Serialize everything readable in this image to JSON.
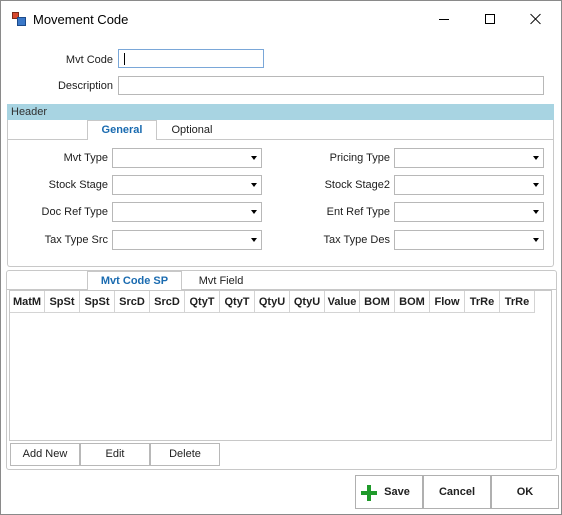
{
  "window": {
    "title": "Movement Code"
  },
  "form": {
    "mvt_code_label": "Mvt Code",
    "mvt_code_value": "",
    "description_label": "Description",
    "description_value": ""
  },
  "header": {
    "title": "Header",
    "tabs": [
      {
        "label": "General",
        "active": true
      },
      {
        "label": "Optional",
        "active": false
      }
    ],
    "fields_left": [
      {
        "label": "Mvt Type",
        "value": ""
      },
      {
        "label": "Stock Stage",
        "value": ""
      },
      {
        "label": "Doc Ref Type",
        "value": ""
      },
      {
        "label": "Tax Type Src",
        "value": ""
      }
    ],
    "fields_right": [
      {
        "label": "Pricing Type",
        "value": ""
      },
      {
        "label": "Stock Stage2",
        "value": ""
      },
      {
        "label": "Ent Ref Type",
        "value": ""
      },
      {
        "label": "Tax Type Des",
        "value": ""
      }
    ]
  },
  "detail": {
    "tabs": [
      {
        "label": "Mvt Code SP",
        "active": true
      },
      {
        "label": "Mvt Field",
        "active": false
      }
    ],
    "columns": [
      "MatM",
      "SpSt",
      "SpSt",
      "SrcD",
      "SrcD",
      "QtyT",
      "QtyT",
      "QtyU",
      "QtyU",
      "Value",
      "BOM",
      "BOM",
      "Flow",
      "TrRe",
      "TrRe"
    ],
    "buttons": {
      "add_new": "Add New",
      "edit": "Edit",
      "delete": "Delete"
    }
  },
  "footer": {
    "save": "Save",
    "cancel": "Cancel",
    "ok": "OK"
  },
  "colors": {
    "header_bar": "#a8d4e2",
    "active_tab": "#1a6bb0",
    "save_icon": "#1f9a2a"
  }
}
